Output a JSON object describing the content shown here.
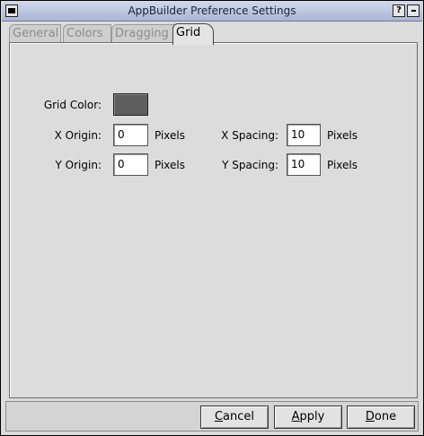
{
  "window": {
    "title": "AppBuilder Preference Settings",
    "help_label": "?"
  },
  "tabs": [
    {
      "label": "General",
      "active": false
    },
    {
      "label": "Colors",
      "active": false
    },
    {
      "label": "Dragging",
      "active": false
    },
    {
      "label": "Grid",
      "active": true
    }
  ],
  "grid": {
    "grid_color_label": "Grid Color:",
    "grid_color_value": "#5e5e5e",
    "x_origin_label": "X Origin:",
    "x_origin_value": "0",
    "y_origin_label": "Y Origin:",
    "y_origin_value": "0",
    "x_spacing_label": "X Spacing:",
    "x_spacing_value": "10",
    "y_spacing_label": "Y Spacing:",
    "y_spacing_value": "10",
    "unit": "Pixels"
  },
  "buttons": {
    "cancel_first": "C",
    "cancel_rest": "ancel",
    "apply_first": "A",
    "apply_rest": "pply",
    "done_first": "D",
    "done_rest": "one"
  }
}
